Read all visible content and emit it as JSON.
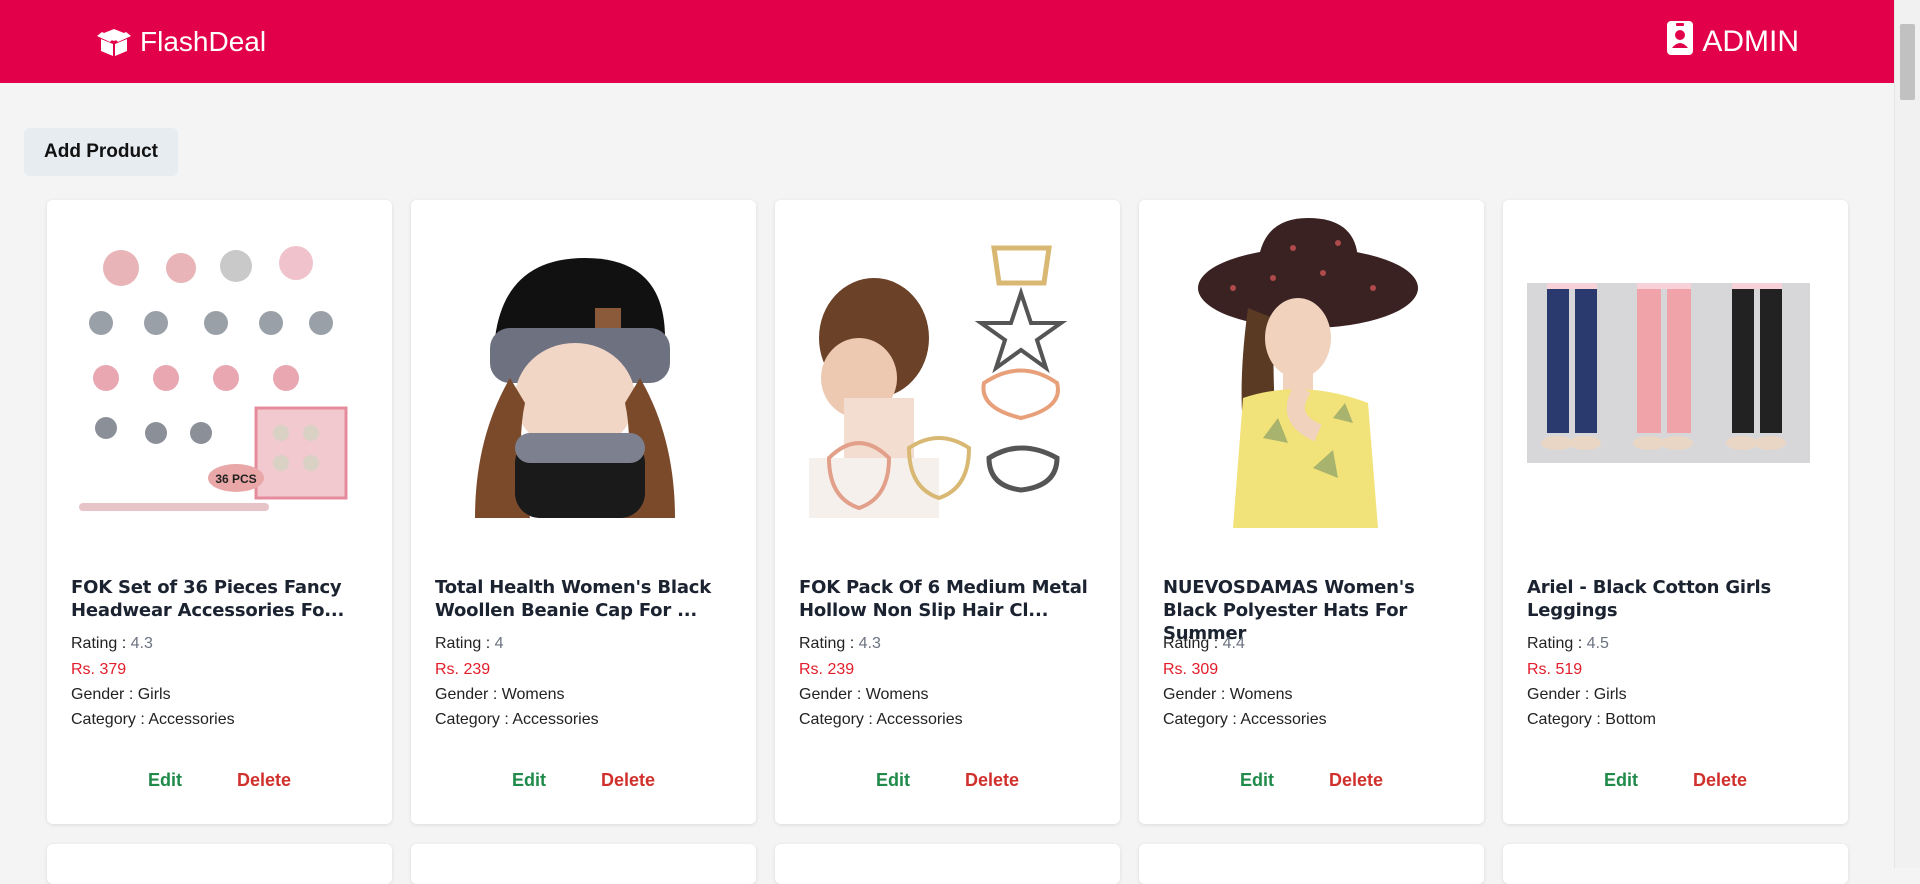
{
  "header": {
    "brand": "FlashDeal",
    "admin_label": "ADMIN"
  },
  "actions": {
    "add_product": "Add Product"
  },
  "labels": {
    "rating": "Rating",
    "gender": "Gender",
    "category": "Category",
    "edit": "Edit",
    "delete": "Delete"
  },
  "products": [
    {
      "name": "FOK Set of 36 Pieces Fancy Headwear Accessories Fo...",
      "rating": "4.3",
      "price": "Rs. 379",
      "gender": "Girls",
      "category": "Accessories",
      "image": "hair-accessories-set",
      "badge": "36 PCS"
    },
    {
      "name": "Total Health Women's Black Woollen Beanie Cap For ...",
      "rating": "4",
      "price": "Rs. 239",
      "gender": "Womens",
      "category": "Accessories",
      "image": "woman-beanie-scarf"
    },
    {
      "name": "FOK Pack Of 6 Medium Metal Hollow Non Slip Hair Cl...",
      "rating": "4.3",
      "price": "Rs. 239",
      "gender": "Womens",
      "category": "Accessories",
      "image": "hair-claw-clips"
    },
    {
      "name": "NUEVOSDAMAS Women's Black Polyester Hats For Summer",
      "rating": "4.4",
      "price": "Rs. 309",
      "gender": "Womens",
      "category": "Accessories",
      "image": "woman-sun-hat"
    },
    {
      "name": "Ariel - Black Cotton Girls Leggings",
      "rating": "4.5",
      "price": "Rs. 519",
      "gender": "Girls",
      "category": "Bottom",
      "image": "girls-leggings"
    }
  ],
  "colors": {
    "brand": "#e3004a",
    "edit": "#1f8a4a",
    "delete": "#d0312d",
    "price": "#e11d2a"
  }
}
